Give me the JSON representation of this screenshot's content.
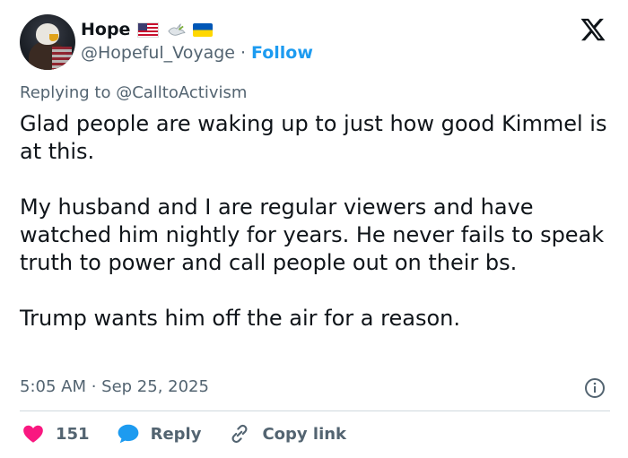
{
  "author": {
    "name": "Hope",
    "handle": "@Hopeful_Voyage",
    "separator": "·",
    "follow_label": "Follow"
  },
  "reply_context": "Replying to @CalltoActivism",
  "tweet": {
    "paragraphs": [
      "Glad people are waking up to just how good Kimmel is at this.",
      "My husband and I are regular viewers and have watched him nightly for years. He never fails to speak truth to power and call people out on their bs.",
      "Trump wants him off the air for a reason."
    ],
    "timestamp": "5:05 AM · Sep 25, 2025"
  },
  "actions": {
    "like_count": "151",
    "reply_label": "Reply",
    "copy_label": "Copy link"
  },
  "icons": {
    "x_logo": "x-logo-icon",
    "info": "info-icon",
    "heart": "heart-icon",
    "reply": "speech-bubble-icon",
    "link": "link-icon"
  },
  "colors": {
    "accent": "#1d9bf0",
    "heart": "#f91880",
    "text": "#0f1419",
    "muted": "#536471"
  }
}
